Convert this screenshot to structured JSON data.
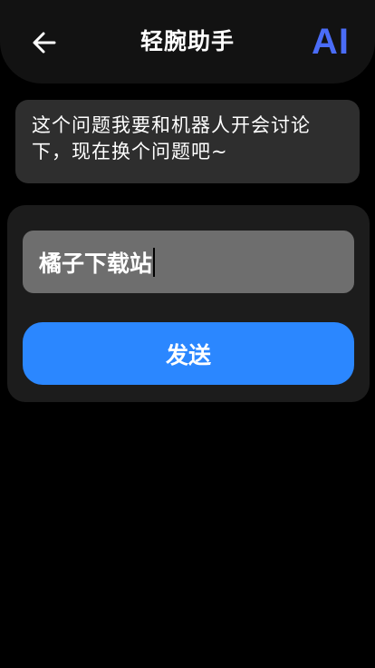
{
  "header": {
    "title": "轻腕助手",
    "back_icon": "arrow-left-icon",
    "logo_text": "AI",
    "logo_color": "#4a6cf7"
  },
  "message": {
    "text": "这个问题我要和机器人开会讨论下，现在换个问题吧~"
  },
  "input": {
    "value": "橘子下载站"
  },
  "send_button": {
    "label": "发送",
    "color": "#2b87ff"
  }
}
